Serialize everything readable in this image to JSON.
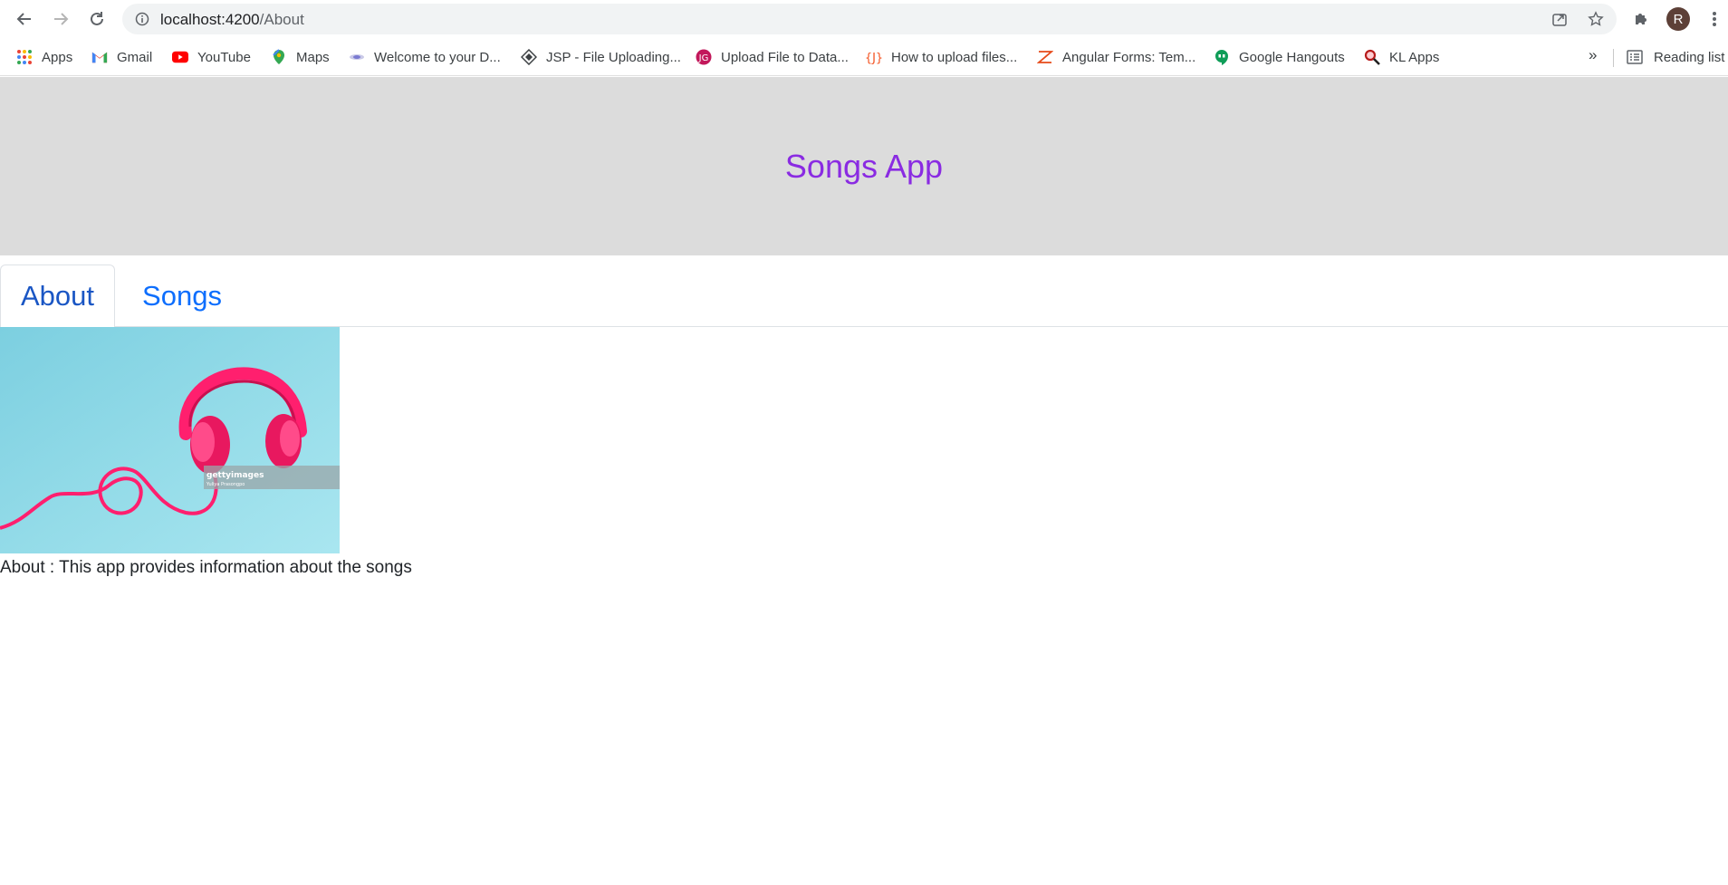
{
  "browser": {
    "url_host": "localhost:4200",
    "url_path": "/About",
    "avatar_letter": "R",
    "bookmarks": [
      {
        "label": "Apps",
        "icon": "apps-grid-icon"
      },
      {
        "label": "Gmail",
        "icon": "gmail-icon"
      },
      {
        "label": "YouTube",
        "icon": "youtube-icon"
      },
      {
        "label": "Maps",
        "icon": "maps-icon"
      },
      {
        "label": "Welcome to your D...",
        "icon": "site-icon"
      },
      {
        "label": "JSP - File Uploading...",
        "icon": "jsp-icon"
      },
      {
        "label": "Upload File to Data...",
        "icon": "upload-site-icon"
      },
      {
        "label": "How to upload files...",
        "icon": "javatpoint-icon"
      },
      {
        "label": "Angular Forms: Tem...",
        "icon": "angular-forms-icon"
      },
      {
        "label": "Google Hangouts",
        "icon": "hangouts-icon"
      },
      {
        "label": "KL Apps",
        "icon": "search-magnifier-icon"
      }
    ],
    "more_label": "»",
    "reading_list_label": "Reading list"
  },
  "app": {
    "title": "Songs App",
    "tabs": [
      {
        "label": "About",
        "active": true
      },
      {
        "label": "Songs",
        "active": false
      }
    ],
    "image": {
      "subject": "pink-headphones",
      "watermark": "gettyimages",
      "credit": "Yuliya Prasongpo"
    },
    "about_text": "About : This app provides information about the songs"
  },
  "colors": {
    "title": "#8a2be2",
    "header_bg": "#dcdcdc",
    "tab_link": "#0d6efd",
    "image_bg": "#86d3e3",
    "headphones": "#ff1f6e"
  }
}
